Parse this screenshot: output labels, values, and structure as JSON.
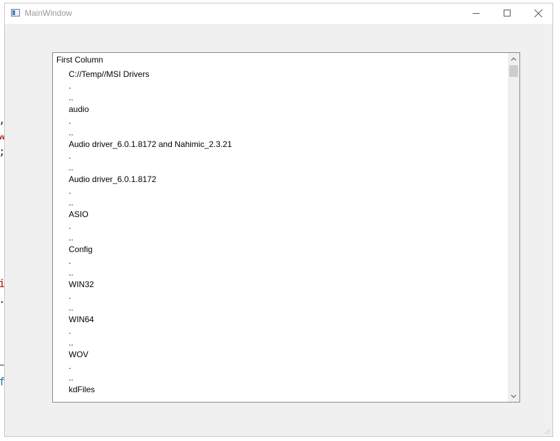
{
  "window": {
    "title": "MainWindow",
    "controls": {
      "minimize": "minimize-icon",
      "maximize": "maximize-icon",
      "close": "close-icon"
    }
  },
  "background": {
    "fragments": [
      ",",
      "w",
      ";",
      "i",
      ".",
      "f"
    ],
    "colors": {
      "dark": "#333333",
      "red": "#a31515",
      "teal": "#267f99"
    }
  },
  "tree": {
    "header": "First Column",
    "rows": [
      "C://Temp//MSI Drivers",
      ".",
      "..",
      "audio",
      ".",
      "..",
      "Audio driver_6.0.1.8172 and Nahimic_2.3.21",
      ".",
      "..",
      "Audio driver_6.0.1.8172",
      ".",
      "..",
      "ASIO",
      ".",
      "..",
      "Config",
      ".",
      "..",
      "WIN32",
      ".",
      "..",
      "WIN64",
      ".",
      "..",
      "WOV",
      ".",
      "..",
      "kdFiles"
    ]
  },
  "scrollbar": {
    "up_icon": "chevron-up-icon",
    "down_icon": "chevron-down-icon"
  }
}
